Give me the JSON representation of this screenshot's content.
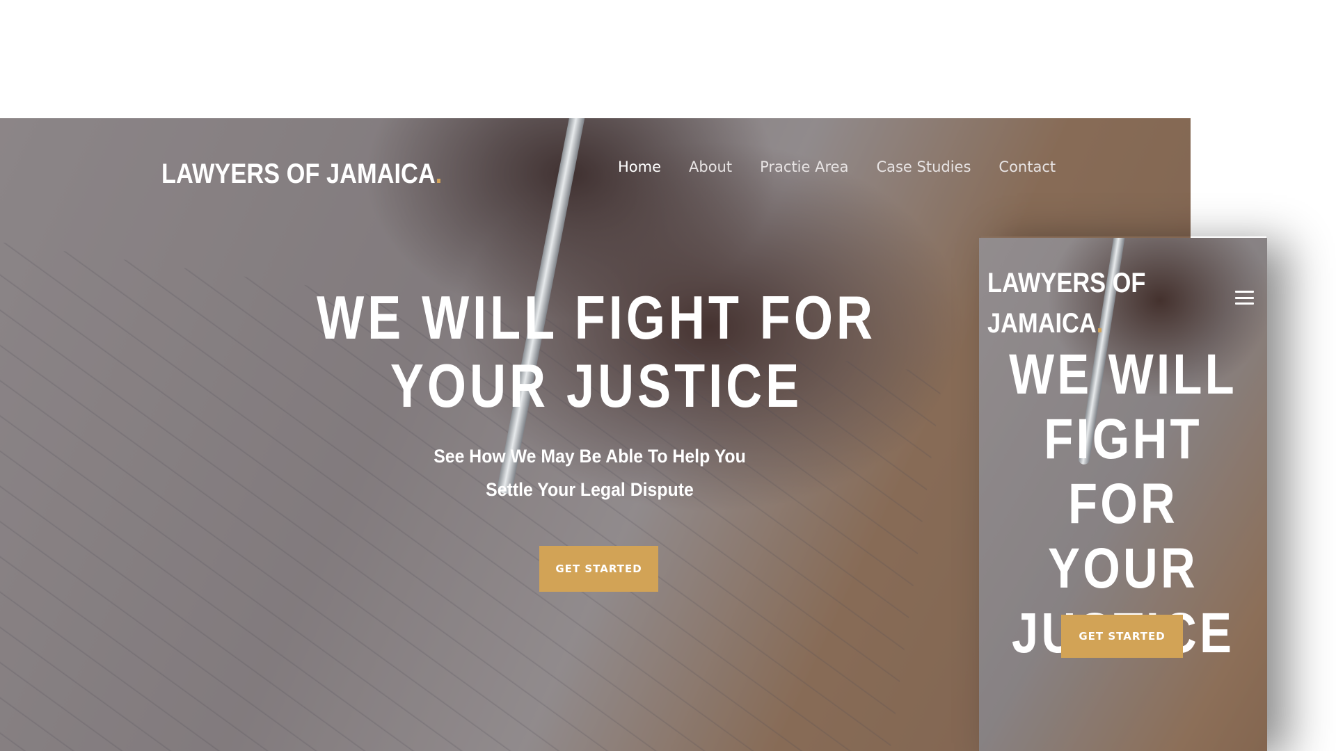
{
  "desktop": {
    "logo": {
      "text": "LAWYERS OF JAMAICA",
      "dot": "."
    },
    "nav": [
      {
        "label": "Home",
        "active": true
      },
      {
        "label": "About"
      },
      {
        "label": "Practie Area"
      },
      {
        "label": "Case Studies"
      },
      {
        "label": "Contact"
      }
    ],
    "hero": {
      "title_line1": "WE WILL FIGHT FOR",
      "title_line2": "YOUR JUSTICE",
      "subtitle_line1": "See How We May Be Able To Help You",
      "subtitle_line2": "Settle Your Legal Dispute",
      "cta": "GET STARTED"
    }
  },
  "mobile": {
    "logo": {
      "line1": "LAWYERS OF",
      "line2": "JAMAICA",
      "dot": "."
    },
    "menu_icon": "hamburger-menu-icon",
    "hero": {
      "title_lines": [
        "WE WILL",
        "FIGHT FOR",
        "YOUR",
        "JUSTICE"
      ],
      "cta": "GET STARTED"
    }
  },
  "colors": {
    "accent": "#d2a356",
    "text": "#ffffff",
    "overlay": "#3a343e"
  }
}
